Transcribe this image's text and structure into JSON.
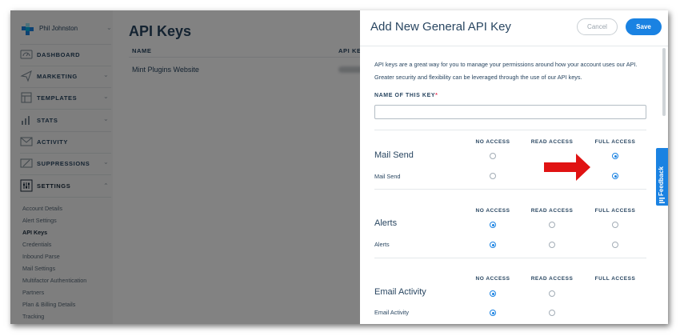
{
  "sidebar": {
    "user_name": "Phil Johnston",
    "nav": [
      {
        "label": "DASHBOARD",
        "icon": "dashboard-icon"
      },
      {
        "label": "MARKETING",
        "icon": "marketing-icon"
      },
      {
        "label": "TEMPLATES",
        "icon": "templates-icon"
      },
      {
        "label": "STATS",
        "icon": "stats-icon"
      },
      {
        "label": "ACTIVITY",
        "icon": "activity-icon"
      },
      {
        "label": "SUPPRESSIONS",
        "icon": "suppressions-icon"
      },
      {
        "label": "SETTINGS",
        "icon": "settings-icon"
      }
    ],
    "settings_items": [
      {
        "label": "Account Details",
        "active": false
      },
      {
        "label": "Alert Settings",
        "active": false
      },
      {
        "label": "API Keys",
        "active": true
      },
      {
        "label": "Credentials",
        "active": false
      },
      {
        "label": "Inbound Parse",
        "active": false
      },
      {
        "label": "Mail Settings",
        "active": false
      },
      {
        "label": "Multifactor Authentication",
        "active": false
      },
      {
        "label": "Partners",
        "active": false
      },
      {
        "label": "Plan & Billing Details",
        "active": false
      },
      {
        "label": "Tracking",
        "active": false
      }
    ]
  },
  "main": {
    "title": "API Keys",
    "columns": {
      "name": "NAME",
      "api_key": "API KE"
    },
    "rows": [
      {
        "name": "Mint Plugins Website"
      }
    ]
  },
  "modal": {
    "title": "Add New General API Key",
    "cancel_label": "Cancel",
    "save_label": "Save",
    "intro": "API keys are a great way for you to manage your permissions around how your account uses our API. Greater security and flexibility can be leveraged through the use of our API keys.",
    "name_label": "NAME OF THIS KEY",
    "required_mark": "*",
    "name_value": "",
    "permission_columns": [
      "NO ACCESS",
      "READ ACCESS",
      "FULL ACCESS"
    ],
    "permission_sections": [
      {
        "title": "Mail Send",
        "rows": [
          {
            "label": "",
            "options": [
              "none",
              "full"
            ],
            "selected": "full"
          },
          {
            "label": "Mail Send",
            "options": [
              "none",
              "full"
            ],
            "selected": "full"
          }
        ]
      },
      {
        "title": "Alerts",
        "rows": [
          {
            "label": "",
            "options": [
              "none",
              "read",
              "full"
            ],
            "selected": "none"
          },
          {
            "label": "Alerts",
            "options": [
              "none",
              "read",
              "full"
            ],
            "selected": "none"
          }
        ]
      },
      {
        "title": "Email Activity",
        "rows": [
          {
            "label": "",
            "options": [
              "none",
              "read"
            ],
            "selected": "none"
          },
          {
            "label": "Email Activity",
            "options": [
              "none",
              "read"
            ],
            "selected": "none"
          }
        ]
      }
    ]
  },
  "feedback_label": "Feedback",
  "colors": {
    "accent": "#1a82e2",
    "text": "#294661",
    "annotation_arrow": "#e01313",
    "required": "#e8385a"
  }
}
